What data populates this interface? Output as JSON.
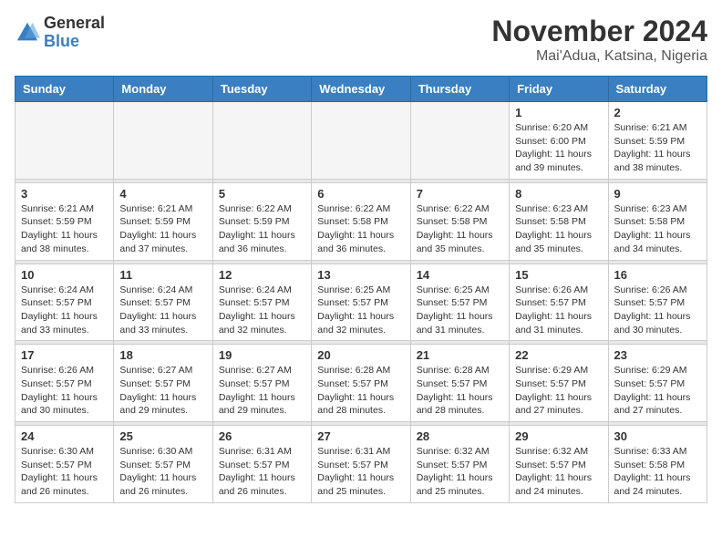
{
  "header": {
    "logo_general": "General",
    "logo_blue": "Blue",
    "title": "November 2024",
    "subtitle": "Mai'Adua, Katsina, Nigeria"
  },
  "days_of_week": [
    "Sunday",
    "Monday",
    "Tuesday",
    "Wednesday",
    "Thursday",
    "Friday",
    "Saturday"
  ],
  "weeks": [
    [
      {
        "day": "",
        "info": ""
      },
      {
        "day": "",
        "info": ""
      },
      {
        "day": "",
        "info": ""
      },
      {
        "day": "",
        "info": ""
      },
      {
        "day": "",
        "info": ""
      },
      {
        "day": "1",
        "info": "Sunrise: 6:20 AM\nSunset: 6:00 PM\nDaylight: 11 hours and 39 minutes."
      },
      {
        "day": "2",
        "info": "Sunrise: 6:21 AM\nSunset: 5:59 PM\nDaylight: 11 hours and 38 minutes."
      }
    ],
    [
      {
        "day": "3",
        "info": "Sunrise: 6:21 AM\nSunset: 5:59 PM\nDaylight: 11 hours and 38 minutes."
      },
      {
        "day": "4",
        "info": "Sunrise: 6:21 AM\nSunset: 5:59 PM\nDaylight: 11 hours and 37 minutes."
      },
      {
        "day": "5",
        "info": "Sunrise: 6:22 AM\nSunset: 5:59 PM\nDaylight: 11 hours and 36 minutes."
      },
      {
        "day": "6",
        "info": "Sunrise: 6:22 AM\nSunset: 5:58 PM\nDaylight: 11 hours and 36 minutes."
      },
      {
        "day": "7",
        "info": "Sunrise: 6:22 AM\nSunset: 5:58 PM\nDaylight: 11 hours and 35 minutes."
      },
      {
        "day": "8",
        "info": "Sunrise: 6:23 AM\nSunset: 5:58 PM\nDaylight: 11 hours and 35 minutes."
      },
      {
        "day": "9",
        "info": "Sunrise: 6:23 AM\nSunset: 5:58 PM\nDaylight: 11 hours and 34 minutes."
      }
    ],
    [
      {
        "day": "10",
        "info": "Sunrise: 6:24 AM\nSunset: 5:57 PM\nDaylight: 11 hours and 33 minutes."
      },
      {
        "day": "11",
        "info": "Sunrise: 6:24 AM\nSunset: 5:57 PM\nDaylight: 11 hours and 33 minutes."
      },
      {
        "day": "12",
        "info": "Sunrise: 6:24 AM\nSunset: 5:57 PM\nDaylight: 11 hours and 32 minutes."
      },
      {
        "day": "13",
        "info": "Sunrise: 6:25 AM\nSunset: 5:57 PM\nDaylight: 11 hours and 32 minutes."
      },
      {
        "day": "14",
        "info": "Sunrise: 6:25 AM\nSunset: 5:57 PM\nDaylight: 11 hours and 31 minutes."
      },
      {
        "day": "15",
        "info": "Sunrise: 6:26 AM\nSunset: 5:57 PM\nDaylight: 11 hours and 31 minutes."
      },
      {
        "day": "16",
        "info": "Sunrise: 6:26 AM\nSunset: 5:57 PM\nDaylight: 11 hours and 30 minutes."
      }
    ],
    [
      {
        "day": "17",
        "info": "Sunrise: 6:26 AM\nSunset: 5:57 PM\nDaylight: 11 hours and 30 minutes."
      },
      {
        "day": "18",
        "info": "Sunrise: 6:27 AM\nSunset: 5:57 PM\nDaylight: 11 hours and 29 minutes."
      },
      {
        "day": "19",
        "info": "Sunrise: 6:27 AM\nSunset: 5:57 PM\nDaylight: 11 hours and 29 minutes."
      },
      {
        "day": "20",
        "info": "Sunrise: 6:28 AM\nSunset: 5:57 PM\nDaylight: 11 hours and 28 minutes."
      },
      {
        "day": "21",
        "info": "Sunrise: 6:28 AM\nSunset: 5:57 PM\nDaylight: 11 hours and 28 minutes."
      },
      {
        "day": "22",
        "info": "Sunrise: 6:29 AM\nSunset: 5:57 PM\nDaylight: 11 hours and 27 minutes."
      },
      {
        "day": "23",
        "info": "Sunrise: 6:29 AM\nSunset: 5:57 PM\nDaylight: 11 hours and 27 minutes."
      }
    ],
    [
      {
        "day": "24",
        "info": "Sunrise: 6:30 AM\nSunset: 5:57 PM\nDaylight: 11 hours and 26 minutes."
      },
      {
        "day": "25",
        "info": "Sunrise: 6:30 AM\nSunset: 5:57 PM\nDaylight: 11 hours and 26 minutes."
      },
      {
        "day": "26",
        "info": "Sunrise: 6:31 AM\nSunset: 5:57 PM\nDaylight: 11 hours and 26 minutes."
      },
      {
        "day": "27",
        "info": "Sunrise: 6:31 AM\nSunset: 5:57 PM\nDaylight: 11 hours and 25 minutes."
      },
      {
        "day": "28",
        "info": "Sunrise: 6:32 AM\nSunset: 5:57 PM\nDaylight: 11 hours and 25 minutes."
      },
      {
        "day": "29",
        "info": "Sunrise: 6:32 AM\nSunset: 5:57 PM\nDaylight: 11 hours and 24 minutes."
      },
      {
        "day": "30",
        "info": "Sunrise: 6:33 AM\nSunset: 5:58 PM\nDaylight: 11 hours and 24 minutes."
      }
    ]
  ]
}
